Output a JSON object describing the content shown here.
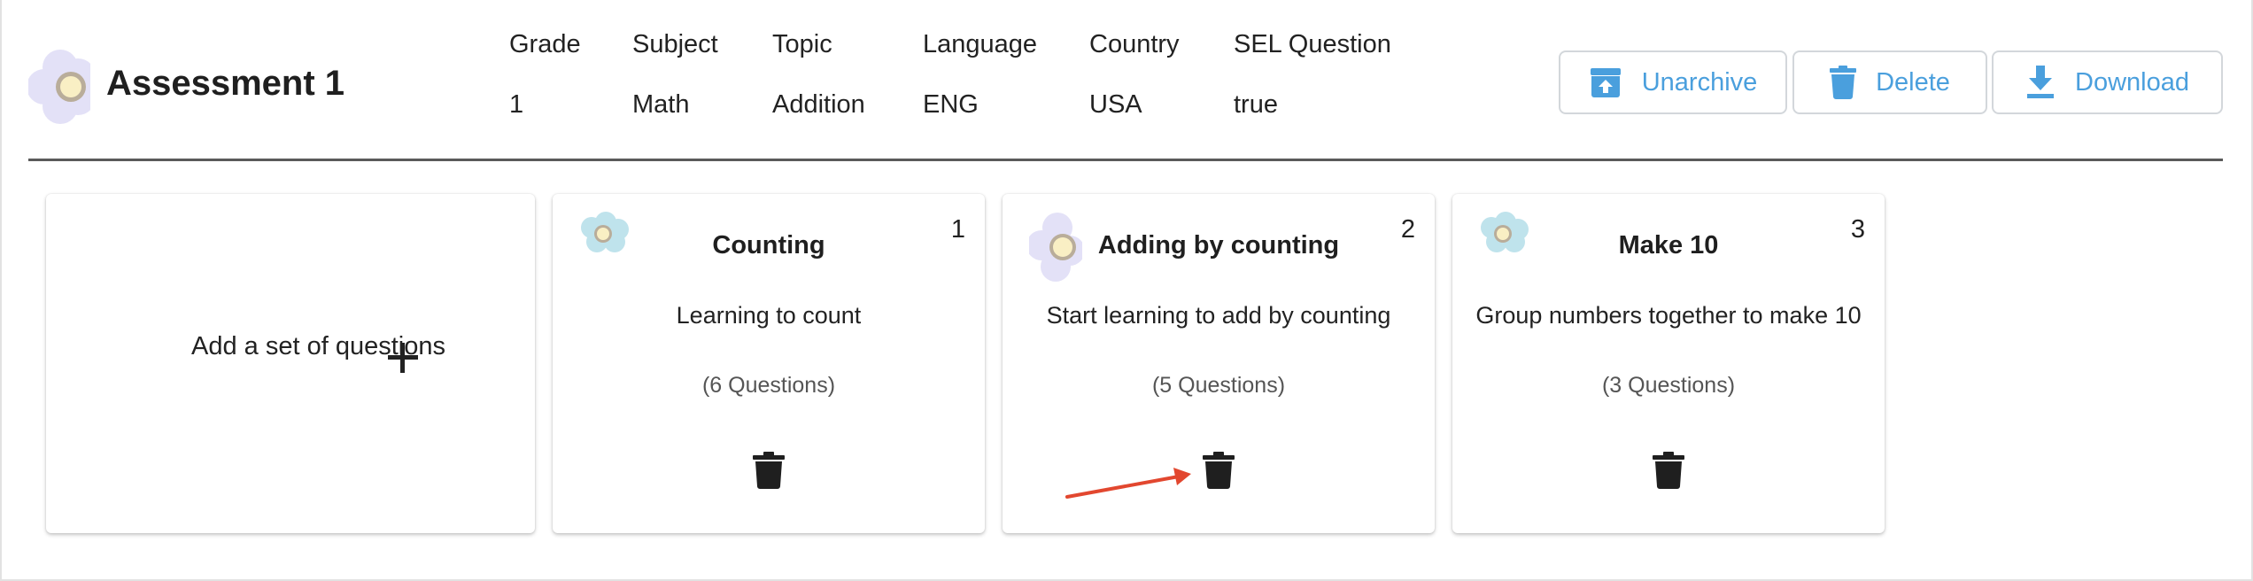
{
  "assessment": {
    "title": "Assessment 1"
  },
  "metadata": [
    {
      "label": "Grade",
      "value": "1"
    },
    {
      "label": "Subject",
      "value": "Math"
    },
    {
      "label": "Topic",
      "value": "Addition"
    },
    {
      "label": "Language",
      "value": "ENG"
    },
    {
      "label": "Country",
      "value": "USA"
    },
    {
      "label": "SEL Question",
      "value": "true"
    }
  ],
  "actions": {
    "unarchive_label": "Unarchive",
    "delete_label": "Delete",
    "download_label": "Download"
  },
  "add_card": {
    "label": "Add a set of questions",
    "icon": "plus-icon"
  },
  "question_sets": [
    {
      "number": "1",
      "title": "Counting",
      "description": "Learning to count",
      "count": "(6 Questions)",
      "icon": "flower-icon"
    },
    {
      "number": "2",
      "title": "Adding by counting",
      "description": "Start learning to add by counting",
      "count": "(5 Questions)",
      "icon": "flower-icon"
    },
    {
      "number": "3",
      "title": "Make 10",
      "description": "Group numbers together to make 10",
      "count": "(3 Questions)",
      "icon": "flower-icon"
    }
  ],
  "colors": {
    "accent": "#4a9fdd",
    "annotation_arrow": "#e2472f",
    "flower_purple": "#e3e1f7",
    "flower_blue": "#bfe3ec",
    "flower_center": "#f7e9b8"
  }
}
